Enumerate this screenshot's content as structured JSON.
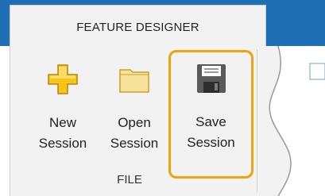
{
  "ribbon": {
    "tab_label": "FEATURE DESIGNER",
    "group_label": "FILE",
    "buttons": [
      {
        "id": "new",
        "label": "New\nSession",
        "icon": "new-session-plus-icon"
      },
      {
        "id": "open",
        "label": "Open\nSession",
        "icon": "folder-icon"
      },
      {
        "id": "save",
        "label": "Save\nSession",
        "icon": "floppy-disk-icon",
        "highlighted": true
      }
    ]
  },
  "colors": {
    "header_blue": "#1f6fb5",
    "ribbon_bg": "#f2f2f2",
    "highlight": "#f0a30a",
    "plus_yellow": "#f5c518",
    "folder_yellow": "#f6e29a"
  }
}
